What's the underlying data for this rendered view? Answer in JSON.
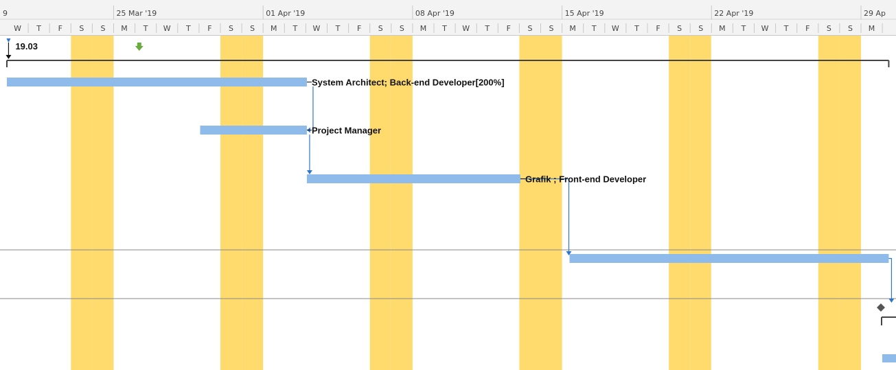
{
  "timescale": {
    "weeks": [
      {
        "label": "9",
        "first_day_index": -2
      },
      {
        "label": "25 Mar '19",
        "first_day_index": 5
      },
      {
        "label": "01 Apr '19",
        "first_day_index": 12
      },
      {
        "label": "08 Apr '19",
        "first_day_index": 19
      },
      {
        "label": "15 Apr '19",
        "first_day_index": 26
      },
      {
        "label": "22 Apr '19",
        "first_day_index": 33
      },
      {
        "label": "29 Ap",
        "first_day_index": 40
      }
    ],
    "days": [
      "W",
      "T",
      "F",
      "S",
      "S",
      "M",
      "T",
      "W",
      "T",
      "F",
      "S",
      "S",
      "M",
      "T",
      "W",
      "T",
      "F",
      "S",
      "S",
      "M",
      "T",
      "W",
      "T",
      "F",
      "S",
      "S",
      "M",
      "T",
      "W",
      "T",
      "F",
      "S",
      "S",
      "M",
      "T",
      "W",
      "T",
      "F",
      "S",
      "S",
      "M"
    ],
    "nonworking_day_indices": [
      3,
      4,
      10,
      11,
      17,
      18,
      24,
      25,
      31,
      32,
      38,
      39
    ]
  },
  "milestone": {
    "label": "19.03",
    "day": -0.05
  },
  "summary_task": {
    "start_day": 0,
    "end_day": 41.3
  },
  "tasks": [
    {
      "name": "task-1",
      "start_day": 0,
      "end_day": 14.05,
      "resources": "System Architect; Back-end Developer[200%]"
    },
    {
      "name": "task-2",
      "start_day": 9.05,
      "end_day": 14.05,
      "resources": "Project Manager"
    },
    {
      "name": "task-3",
      "start_day": 14.05,
      "end_day": 24.05,
      "resources": "Grafik ; Front-end Developer"
    },
    {
      "name": "task-4",
      "start_day": 26.35,
      "end_day": 41.3,
      "resources": ""
    }
  ],
  "colors": {
    "nonworking": "#FFDB6E",
    "task_bar": "#8FBBEB",
    "link": "#2F75C8",
    "summary": "#444444",
    "grid_line": "#8a8a8a",
    "header_bg": "#F3F3F3",
    "indicator": "#6AAB3E"
  },
  "icons": {
    "deadline_indicator": "down-arrow-icon",
    "milestone": "milestone-diamond-icon"
  }
}
